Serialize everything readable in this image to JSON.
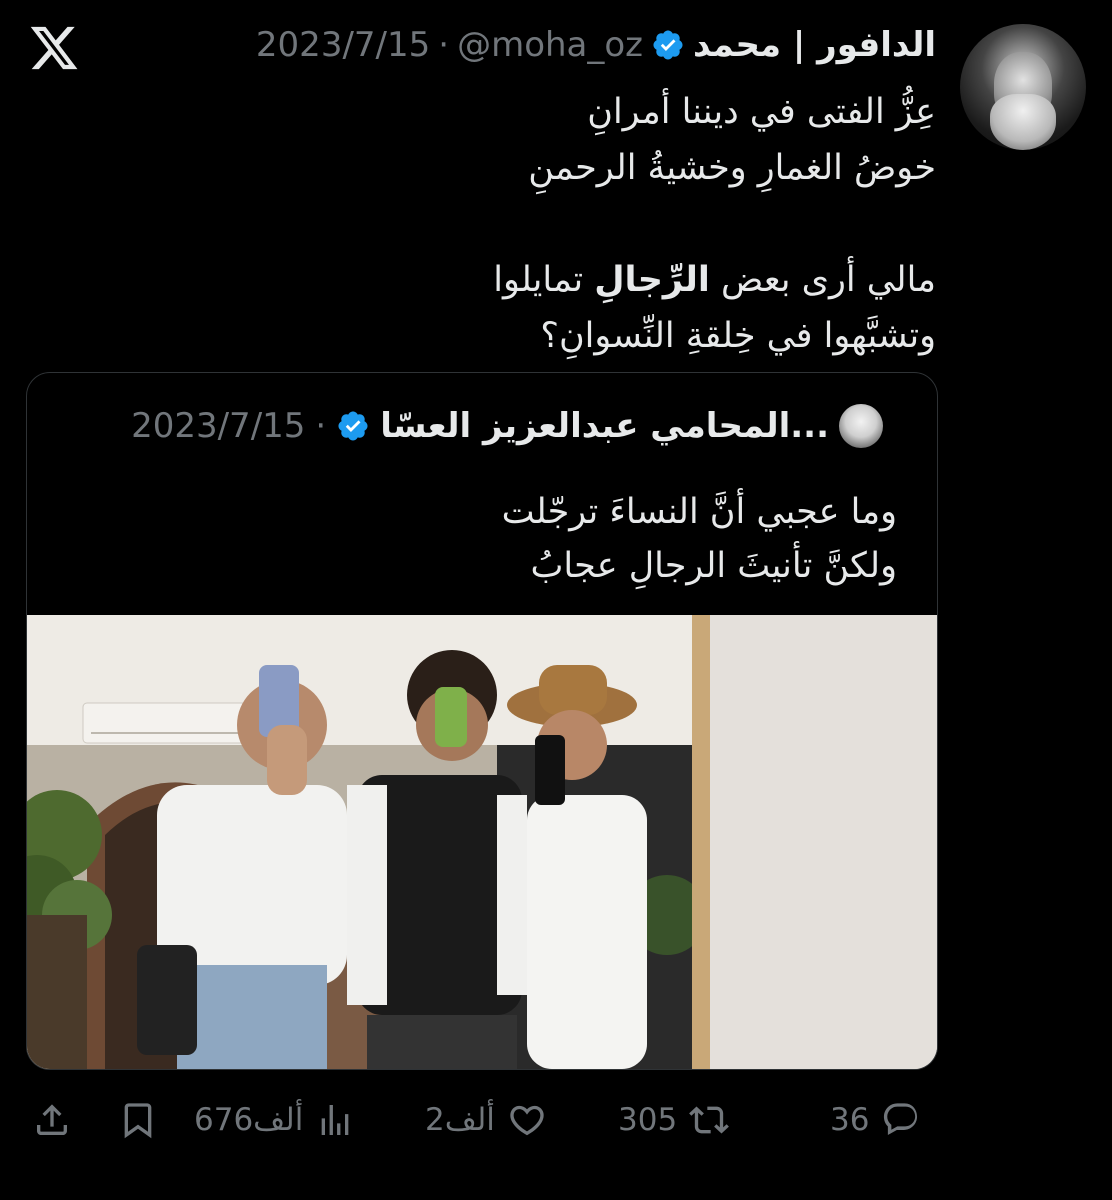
{
  "tweet": {
    "display_name": "الدافور | محمد",
    "handle": "@moha_oz",
    "separator": "·",
    "date": "2023/7/15",
    "lines": [
      "عِزُّ الفتى في ديننا أمرانِ",
      "خوضُ الغمارِ وخشيةُ الرحمنِ",
      "",
      "مالي أرى بعض الرِّجالِ تمايلوا",
      "وتشبَّهوا في خِلقةِ النِّسوانِ؟"
    ]
  },
  "quote": {
    "display_name": "المحامي عبدالعزيز العسّا...",
    "separator": "·",
    "date": "2023/7/15",
    "lines": [
      "وما عجبي أنَّ النساءَ ترجّلت",
      "ولكنَّ تأنيثَ الرجالِ عجابُ"
    ]
  },
  "actions": {
    "replies": "36",
    "retweets": "305",
    "likes": "2ألف",
    "views": "676ألف"
  },
  "icons": {
    "logo": "x-logo-icon",
    "verified": "verified-badge-icon",
    "reply": "reply-icon",
    "retweet": "retweet-icon",
    "like": "heart-icon",
    "views": "views-icon",
    "bookmark": "bookmark-icon",
    "share": "share-icon"
  },
  "colors": {
    "background": "#000000",
    "text": "#e7e9ea",
    "muted": "#71767b",
    "verified": "#1d9bf0",
    "border": "#2f3336"
  }
}
